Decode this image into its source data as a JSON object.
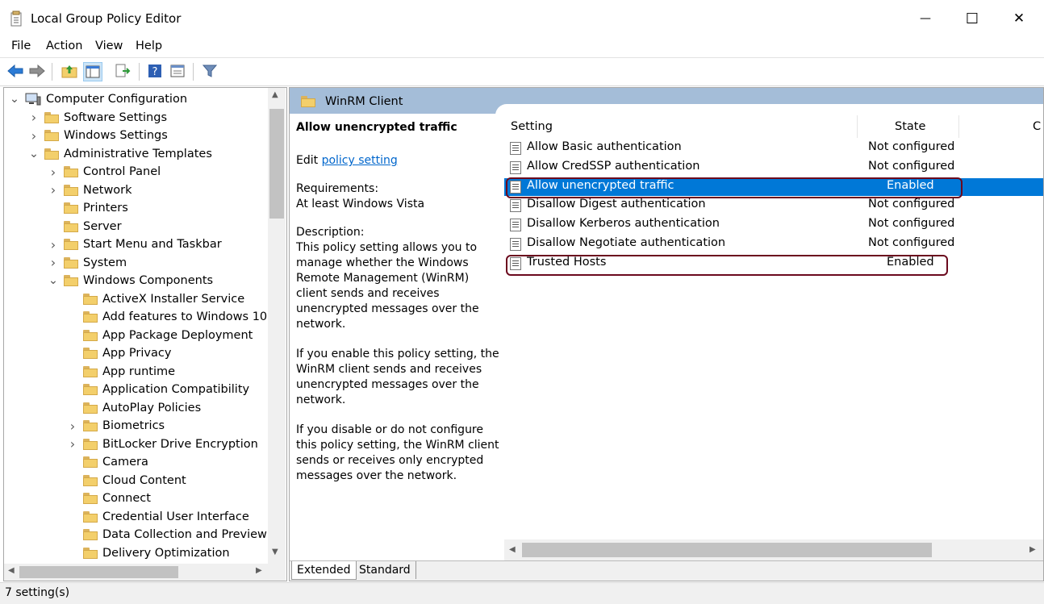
{
  "window": {
    "title": "Local Group Policy Editor",
    "minimize_glyph": "—",
    "maximize_glyph": "☐",
    "close_glyph": "✕"
  },
  "menu": [
    "File",
    "Action",
    "View",
    "Help"
  ],
  "toolbar_icons": [
    "back-arrow-icon",
    "forward-arrow-icon",
    "up-folder-icon",
    "show-hide-tree-icon",
    "export-list-icon",
    "help-icon",
    "properties-icon",
    "filter-icon"
  ],
  "tree": {
    "items": [
      {
        "label": "Computer Configuration",
        "level": 0,
        "expander": "open",
        "icon": "computer"
      },
      {
        "label": "Software Settings",
        "level": 1,
        "expander": "closed",
        "icon": "folder"
      },
      {
        "label": "Windows Settings",
        "level": 1,
        "expander": "closed",
        "icon": "folder"
      },
      {
        "label": "Administrative Templates",
        "level": 1,
        "expander": "open",
        "icon": "folder"
      },
      {
        "label": "Control Panel",
        "level": 2,
        "expander": "closed",
        "icon": "folder"
      },
      {
        "label": "Network",
        "level": 2,
        "expander": "closed",
        "icon": "folder"
      },
      {
        "label": "Printers",
        "level": 2,
        "expander": "none",
        "icon": "folder"
      },
      {
        "label": "Server",
        "level": 2,
        "expander": "none",
        "icon": "folder"
      },
      {
        "label": "Start Menu and Taskbar",
        "level": 2,
        "expander": "closed",
        "icon": "folder"
      },
      {
        "label": "System",
        "level": 2,
        "expander": "closed",
        "icon": "folder"
      },
      {
        "label": "Windows Components",
        "level": 2,
        "expander": "open",
        "icon": "folder"
      },
      {
        "label": "ActiveX Installer Service",
        "level": 3,
        "expander": "none",
        "icon": "folder"
      },
      {
        "label": "Add features to Windows 10",
        "level": 3,
        "expander": "none",
        "icon": "folder"
      },
      {
        "label": "App Package Deployment",
        "level": 3,
        "expander": "none",
        "icon": "folder"
      },
      {
        "label": "App Privacy",
        "level": 3,
        "expander": "none",
        "icon": "folder"
      },
      {
        "label": "App runtime",
        "level": 3,
        "expander": "none",
        "icon": "folder"
      },
      {
        "label": "Application Compatibility",
        "level": 3,
        "expander": "none",
        "icon": "folder"
      },
      {
        "label": "AutoPlay Policies",
        "level": 3,
        "expander": "none",
        "icon": "folder"
      },
      {
        "label": "Biometrics",
        "level": 3,
        "expander": "closed",
        "icon": "folder"
      },
      {
        "label": "BitLocker Drive Encryption",
        "level": 3,
        "expander": "closed",
        "icon": "folder"
      },
      {
        "label": "Camera",
        "level": 3,
        "expander": "none",
        "icon": "folder"
      },
      {
        "label": "Cloud Content",
        "level": 3,
        "expander": "none",
        "icon": "folder"
      },
      {
        "label": "Connect",
        "level": 3,
        "expander": "none",
        "icon": "folder"
      },
      {
        "label": "Credential User Interface",
        "level": 3,
        "expander": "none",
        "icon": "folder"
      },
      {
        "label": "Data Collection and Preview Bu",
        "level": 3,
        "expander": "none",
        "icon": "folder"
      },
      {
        "label": "Delivery Optimization",
        "level": 3,
        "expander": "none",
        "icon": "folder"
      }
    ]
  },
  "details": {
    "folder_title": "WinRM Client",
    "policy_name": "Allow unencrypted traffic",
    "edit_prefix": "Edit",
    "edit_link": "policy setting",
    "requirements_label": "Requirements:",
    "requirements_value": "At least Windows Vista",
    "description_label": "Description:",
    "description_paragraphs": [
      "This policy setting allows you to manage whether the Windows Remote Management (WinRM) client sends and receives unencrypted messages over the network.",
      "If you enable this policy setting, the WinRM client sends and receives unencrypted messages over the network.",
      "If you disable or do not configure this policy setting, the WinRM client sends or receives only encrypted messages over the network."
    ]
  },
  "list": {
    "columns": {
      "setting": "Setting",
      "state": "State",
      "comment": "C"
    },
    "rows": [
      {
        "setting": "Allow Basic authentication",
        "state": "Not configured",
        "selected": false,
        "highlighted": false
      },
      {
        "setting": "Allow CredSSP authentication",
        "state": "Not configured",
        "selected": false,
        "highlighted": false
      },
      {
        "setting": "Allow unencrypted traffic",
        "state": "Enabled",
        "selected": true,
        "highlighted": true
      },
      {
        "setting": "Disallow Digest authentication",
        "state": "Not configured",
        "selected": false,
        "highlighted": false
      },
      {
        "setting": "Disallow Kerberos authentication",
        "state": "Not configured",
        "selected": false,
        "highlighted": false
      },
      {
        "setting": "Disallow Negotiate authentication",
        "state": "Not configured",
        "selected": false,
        "highlighted": false
      },
      {
        "setting": "Trusted Hosts",
        "state": "Enabled",
        "selected": false,
        "highlighted": true
      }
    ]
  },
  "tabs": [
    "Extended",
    "Standard"
  ],
  "status": "7 setting(s)",
  "colors": {
    "selection": "#0078d7",
    "highlight_outline": "#6b0a1e",
    "header_band": "#a4bdd8",
    "folder": "#f3cf6b"
  }
}
